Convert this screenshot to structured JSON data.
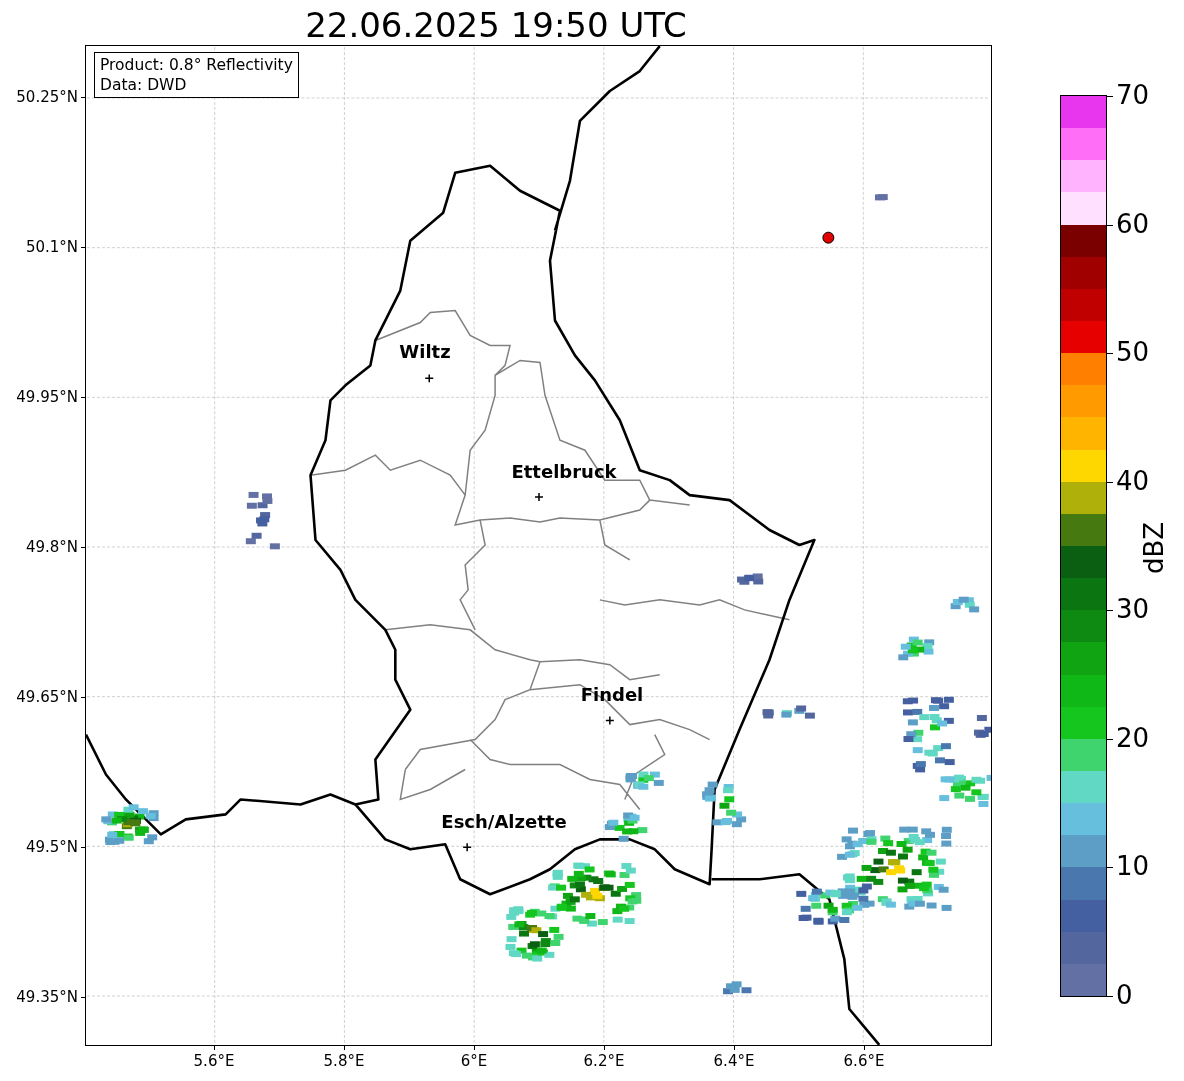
{
  "title": "22.06.2025 19:50 UTC",
  "info_box": [
    "Product: 0.8° Reflectivity",
    "Data: DWD"
  ],
  "lat_ticks": [
    "50.25°N",
    "50.1°N",
    "49.95°N",
    "49.8°N",
    "49.65°N",
    "49.5°N",
    "49.35°N"
  ],
  "lon_ticks": [
    "5.6°E",
    "5.8°E",
    "6°E",
    "6.2°E",
    "6.4°E",
    "6.6°E"
  ],
  "cities": [
    {
      "name": "Wiltz"
    },
    {
      "name": "Ettelbruck"
    },
    {
      "name": "Findel"
    },
    {
      "name": "Esch/Alzette"
    }
  ],
  "colorbar": {
    "label": "dBZ",
    "ticks": [
      "70",
      "60",
      "50",
      "40",
      "30",
      "20",
      "10",
      "0"
    ],
    "bins": [
      {
        "color": "#e836ef"
      },
      {
        "color": "#ff6ef7"
      },
      {
        "color": "#ffb3ff"
      },
      {
        "color": "#ffe0ff"
      },
      {
        "color": "#7a0000"
      },
      {
        "color": "#a00000"
      },
      {
        "color": "#c00000"
      },
      {
        "color": "#e60000"
      },
      {
        "color": "#ff7f00"
      },
      {
        "color": "#ff9a00"
      },
      {
        "color": "#ffb500"
      },
      {
        "color": "#ffd700"
      },
      {
        "color": "#b0b00a"
      },
      {
        "color": "#467a10"
      },
      {
        "color": "#0a5f12"
      },
      {
        "color": "#0b7512"
      },
      {
        "color": "#0e8a12"
      },
      {
        "color": "#10a312"
      },
      {
        "color": "#10b817"
      },
      {
        "color": "#14c61e"
      },
      {
        "color": "#3fd46e"
      },
      {
        "color": "#60d8c3"
      },
      {
        "color": "#66c0dd"
      },
      {
        "color": "#5c9ec6"
      },
      {
        "color": "#4a77ae"
      },
      {
        "color": "#4560a0"
      },
      {
        "color": "#54669e"
      },
      {
        "color": "#6370a4"
      }
    ]
  }
}
